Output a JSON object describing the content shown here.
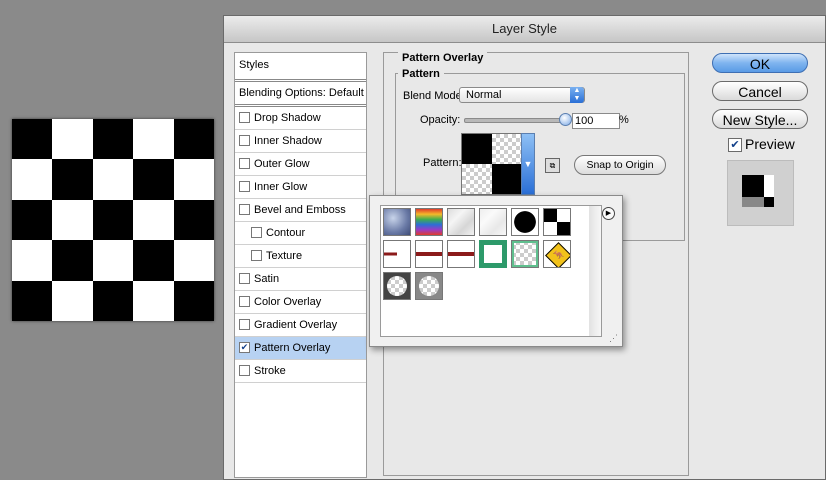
{
  "dialog": {
    "title": "Layer Style"
  },
  "styles_panel": {
    "header": "Styles",
    "blending_options": "Blending Options: Default",
    "items": [
      {
        "label": "Drop Shadow",
        "checked": false,
        "indent": false
      },
      {
        "label": "Inner Shadow",
        "checked": false,
        "indent": false
      },
      {
        "label": "Outer Glow",
        "checked": false,
        "indent": false
      },
      {
        "label": "Inner Glow",
        "checked": false,
        "indent": false
      },
      {
        "label": "Bevel and Emboss",
        "checked": false,
        "indent": false
      },
      {
        "label": "Contour",
        "checked": false,
        "indent": true
      },
      {
        "label": "Texture",
        "checked": false,
        "indent": true
      },
      {
        "label": "Satin",
        "checked": false,
        "indent": false
      },
      {
        "label": "Color Overlay",
        "checked": false,
        "indent": false
      },
      {
        "label": "Gradient Overlay",
        "checked": false,
        "indent": false
      },
      {
        "label": "Pattern Overlay",
        "checked": true,
        "indent": false,
        "selected": true
      },
      {
        "label": "Stroke",
        "checked": false,
        "indent": false
      }
    ]
  },
  "pattern_overlay": {
    "section_title": "Pattern Overlay",
    "group_title": "Pattern",
    "blend_mode_label": "Blend Mode:",
    "blend_mode_value": "Normal",
    "opacity_label": "Opacity:",
    "opacity_value": "100",
    "opacity_unit": "%",
    "opacity_fraction": 1.0,
    "pattern_label": "Pattern:",
    "snap_button": "Snap to Origin"
  },
  "buttons": {
    "ok": "OK",
    "cancel": "Cancel",
    "new_style": "New Style...",
    "preview": "Preview",
    "preview_checked": true
  },
  "pattern_picker": {
    "tiles": [
      "bubbles",
      "tie-dye",
      "gray-granite",
      "gray-granite-light",
      "black-circle",
      "checkerboard",
      "red-line-short",
      "red-line-medium",
      "red-line-long",
      "green-frame",
      "green-frame-checker",
      "kangaroo-sign",
      "circle-dark",
      "circle-light"
    ]
  },
  "colors": {
    "selected_row": "#b7d2f2",
    "accent_blue": "#5a9be6",
    "dialog_bg": "#e8e8e8"
  }
}
